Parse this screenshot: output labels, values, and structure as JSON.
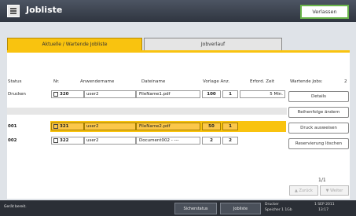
{
  "header": {
    "title": "Jobliste",
    "close_label": "Verlassen"
  },
  "tabs": [
    {
      "label": "Aktuelle / Wartende Jobliste",
      "active": true
    },
    {
      "label": "Jobverlauf",
      "active": false
    }
  ],
  "columns": {
    "status": "Status",
    "nr": "Nr.",
    "user": "Anwendername",
    "file": "Dateiname",
    "pages": "Vorlage Anz.",
    "time": "Erford. Zeit",
    "waiting": "Wartende Jobs:",
    "waiting_count": "2"
  },
  "rows": [
    {
      "status": "Drucken",
      "nr": "320",
      "user": "user2",
      "file": "FileName1.pdf",
      "pages": "100",
      "copies": "1",
      "time": "5 Min.",
      "selected": false
    },
    {
      "status": "001",
      "nr": "321",
      "user": "user2",
      "file": "FileName2.pdf",
      "pages": "50",
      "copies": "1",
      "time": "",
      "selected": true
    },
    {
      "status": "002",
      "nr": "322",
      "user": "user2",
      "file": "Document002 - ---",
      "pages": "2",
      "copies": "2",
      "time": "",
      "selected": false
    }
  ],
  "side_buttons": {
    "details": "Details",
    "reorder": "Reihenfolge ändern",
    "print_now": "Druck ausweisen",
    "delete_reservation": "Reservierung löschen"
  },
  "pagination": {
    "indicator": "1/1",
    "prev": "▲ Zurück",
    "next": "▼ Weiter"
  },
  "statusbar": {
    "message": "Gerät bereit.",
    "btn_status": "Sicherstatus",
    "btn_joblist": "Jobliste",
    "label1": "Drucker",
    "label2": "Speicher 1 1Gb",
    "date": "1 SEP 2011",
    "time": "13:17"
  },
  "colors": {
    "accent": "#f9c30f",
    "header": "#3a404c",
    "close_border": "#6ab54a"
  }
}
